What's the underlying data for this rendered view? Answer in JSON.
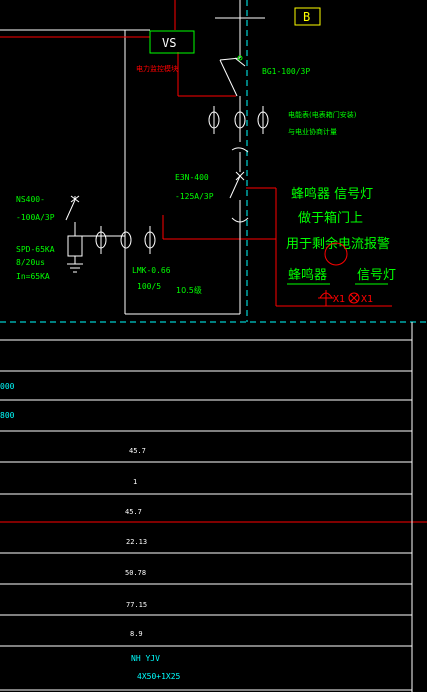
{
  "labels": {
    "page_marker": "B",
    "vs_box": "VS",
    "power_monitor": "电力监控模块",
    "breaker_top": "BG1-100/3P",
    "ct_note_line1": "电能表(电表箱门安装)",
    "ct_note_line2": "与电业协商计量",
    "main_switch_line1": "E3N-400",
    "main_switch_line2": "-125A/3P",
    "spd_breaker_line1": "NS400-",
    "spd_breaker_line2": "-100A/3P",
    "spd_line1": "SPD-65KA",
    "spd_line2": "8/20us",
    "spd_line3": "In=65KA",
    "ct_model_line1": "LMK-0.66",
    "ct_model_line2": "100/5",
    "ct_note_small": "10.5级",
    "buzzer_title": "蜂鸣器 信号灯",
    "buzzer_mount": "做于箱门上",
    "buzzer_purpose": "用于剩余电流报警",
    "buzzer_label": "蜂鸣器",
    "lamp_label": "信号灯",
    "x1_a": "X1",
    "x1_b": "X1"
  },
  "table": {
    "left_values": [
      "000",
      "800"
    ],
    "center_values": [
      "45.7",
      "1",
      "45.7",
      "22.13",
      "50.78",
      "77.15",
      "8.9"
    ],
    "cable_line1": "NH YJV",
    "cable_line2": "4X50+1X25"
  },
  "colors": {
    "background": "#000000",
    "lines_white": "#ffffff",
    "accent_red": "#ff0000",
    "text_green": "#00ff00",
    "text_cyan": "#00ffff",
    "text_yellow": "#ffff00"
  }
}
